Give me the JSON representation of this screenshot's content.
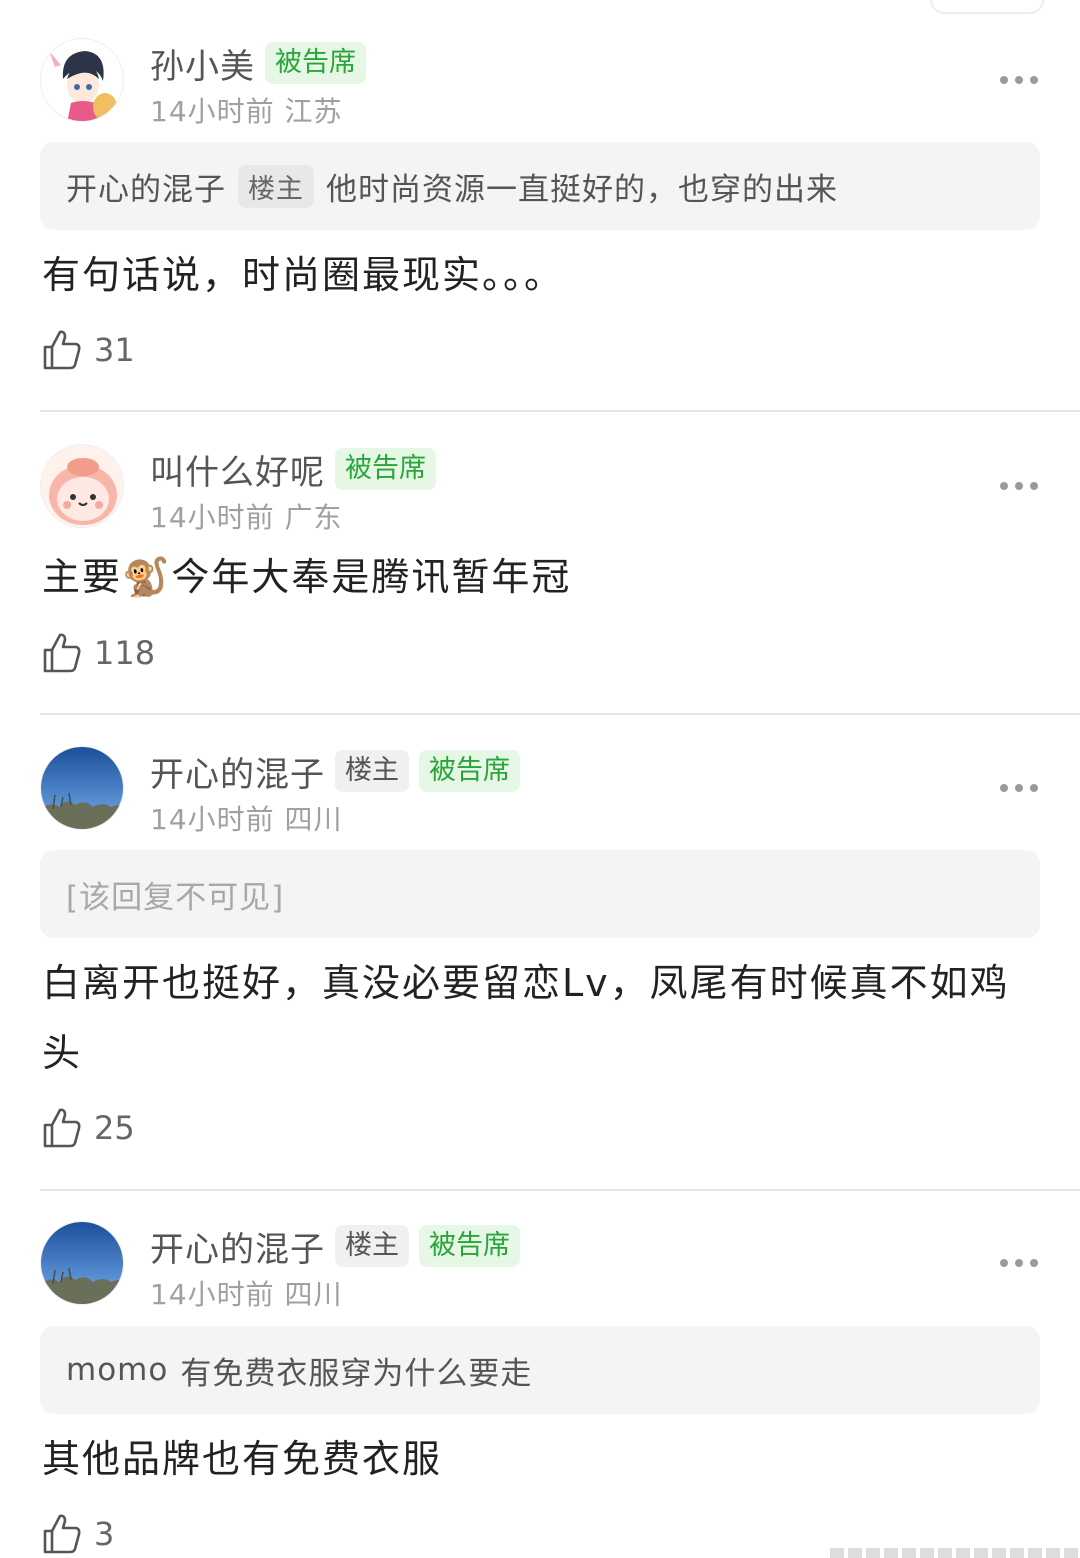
{
  "comments": [
    {
      "user": "孙小美",
      "badges": [
        "被告席"
      ],
      "time": "14小时前",
      "location": "江苏",
      "quote": {
        "author": "开心的混子",
        "author_badge": "楼主",
        "text": "他时尚资源一直挺好的，也穿的出来"
      },
      "body": "有句话说，时尚圈最现实。。。",
      "likes": "31",
      "avatar_icon": "anime-girl-avatar"
    },
    {
      "user": "叫什么好呢",
      "badges": [
        "被告席"
      ],
      "time": "14小时前",
      "location": "广东",
      "body_prefix": "主要",
      "emoji": "🐒",
      "body_suffix": "今年大奉是腾讯暂年冠",
      "likes": "118",
      "avatar_icon": "pink-blob-avatar"
    },
    {
      "user": "开心的混子",
      "badges": [
        "楼主",
        "被告席"
      ],
      "time": "14小时前",
      "location": "四川",
      "quote": {
        "text": "[该回复不可见]"
      },
      "body": "白离开也挺好，真没必要留恋Lv，凤尾有时候真不如鸡头",
      "likes": "25",
      "avatar_icon": "blue-sky-avatar"
    },
    {
      "user": "开心的混子",
      "badges": [
        "楼主",
        "被告席"
      ],
      "time": "14小时前",
      "location": "四川",
      "quote": {
        "author": "momo",
        "text": "有免费衣服穿为什么要走"
      },
      "body": "其他品牌也有免费衣服",
      "likes": "3",
      "avatar_icon": "blue-sky-avatar"
    }
  ],
  "colors": {
    "badge_green_text": "#2aa53a",
    "badge_green_bg": "#e6f7e6",
    "quote_bg": "#f4f4f4",
    "meta_gray": "#a0a0a0"
  }
}
